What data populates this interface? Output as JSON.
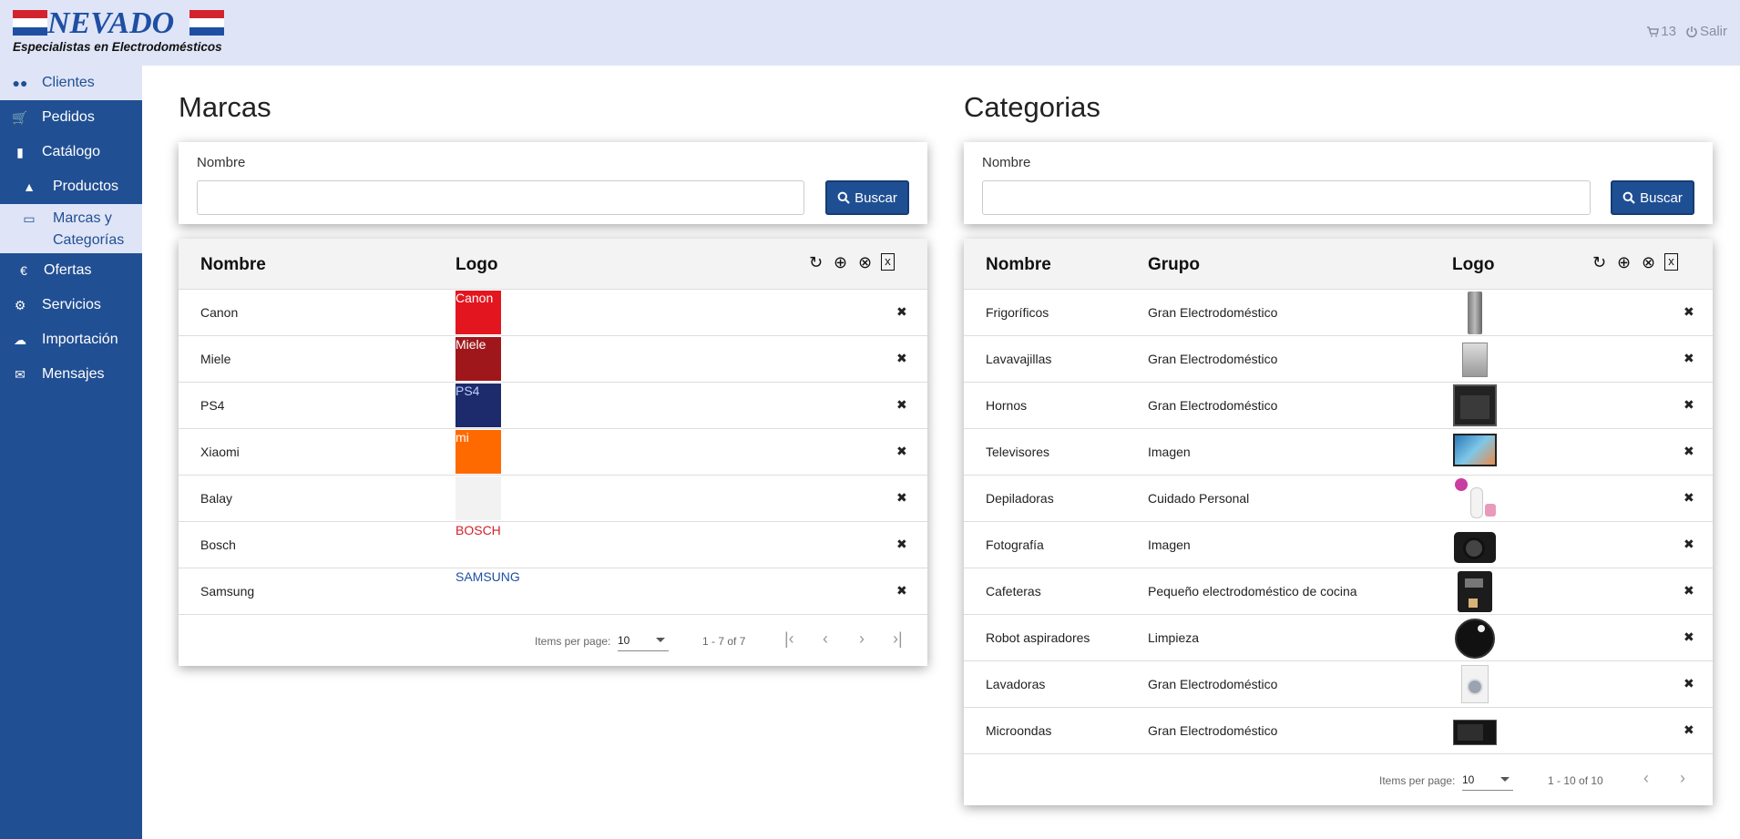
{
  "app": {
    "logo_text": "NEVADO",
    "logo_subtitle": "Especialistas en Electrodomésticos",
    "cart_count": "13",
    "logout_label": "Salir"
  },
  "sidebar": {
    "items": [
      {
        "label": "Clientes",
        "icon": "users-icon"
      },
      {
        "label": "Pedidos",
        "icon": "cart-icon"
      },
      {
        "label": "Catálogo",
        "icon": "book-icon"
      },
      {
        "label": "Productos",
        "icon": "cubes-icon"
      },
      {
        "label": "Marcas y Categorías",
        "icon": "monitor-icon"
      },
      {
        "label": "Ofertas",
        "icon": "euro-icon"
      },
      {
        "label": "Servicios",
        "icon": "gear-icon"
      },
      {
        "label": "Importación",
        "icon": "cloud-upload-icon"
      },
      {
        "label": "Mensajes",
        "icon": "envelope-icon"
      }
    ]
  },
  "marcas": {
    "title": "Marcas",
    "search_label": "Nombre",
    "search_value": "",
    "button_label": "Buscar",
    "columns": [
      "Nombre",
      "Logo"
    ],
    "rows": [
      {
        "nombre": "Canon",
        "logo": "Canon"
      },
      {
        "nombre": "Miele",
        "logo": "Miele"
      },
      {
        "nombre": "PS4",
        "logo": "PS4"
      },
      {
        "nombre": "Xiaomi",
        "logo": "mi"
      },
      {
        "nombre": "Balay",
        "logo": ""
      },
      {
        "nombre": "Bosch",
        "logo": "BOSCH"
      },
      {
        "nombre": "Samsung",
        "logo": "SAMSUNG"
      }
    ],
    "pager": {
      "items_label": "Items per page:",
      "per_page": "10",
      "range": "1 - 7 of 7"
    }
  },
  "categorias": {
    "title": "Categorias",
    "search_label": "Nombre",
    "search_value": "",
    "button_label": "Buscar",
    "columns": [
      "Nombre",
      "Grupo",
      "Logo"
    ],
    "rows": [
      {
        "nombre": "Frigoríficos",
        "grupo": "Gran Electrodoméstico"
      },
      {
        "nombre": "Lavavajillas",
        "grupo": "Gran Electrodoméstico"
      },
      {
        "nombre": "Hornos",
        "grupo": "Gran Electrodoméstico"
      },
      {
        "nombre": "Televisores",
        "grupo": "Imagen"
      },
      {
        "nombre": "Depiladoras",
        "grupo": "Cuidado Personal"
      },
      {
        "nombre": "Fotografía",
        "grupo": "Imagen"
      },
      {
        "nombre": "Cafeteras",
        "grupo": "Pequeño electrodoméstico de cocina"
      },
      {
        "nombre": "Robot aspiradores",
        "grupo": "Limpieza"
      },
      {
        "nombre": "Lavadoras",
        "grupo": "Gran Electrodoméstico"
      },
      {
        "nombre": "Microondas",
        "grupo": "Gran Electrodoméstico"
      }
    ],
    "pager": {
      "items_label": "Items per page:",
      "per_page": "10",
      "range": "1 - 10 of 10"
    }
  }
}
